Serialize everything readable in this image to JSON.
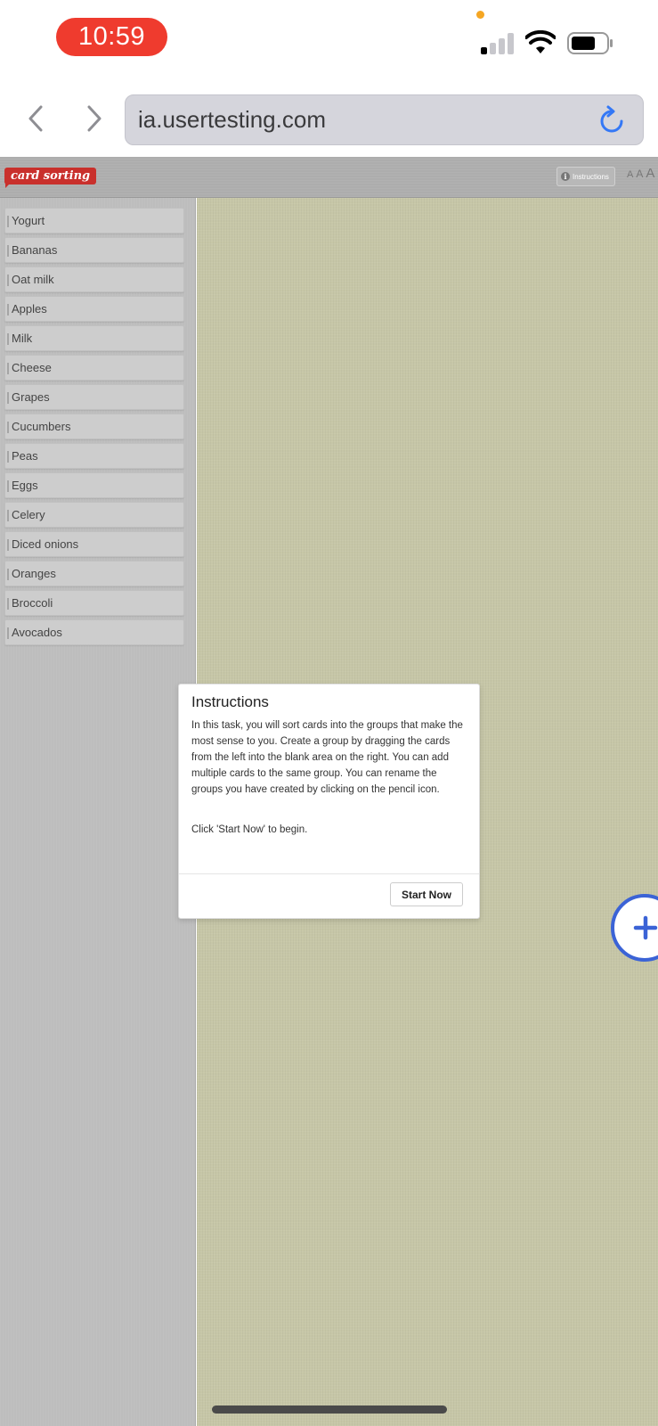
{
  "status_bar": {
    "time": "10:59"
  },
  "browser": {
    "url": "ia.usertesting.com"
  },
  "header": {
    "logo_text": "card sorting",
    "instructions_label": "Instructions",
    "font_sizes": [
      "A",
      "A",
      "A"
    ]
  },
  "cards": [
    "Yogurt",
    "Bananas",
    "Oat milk",
    "Apples",
    "Milk",
    "Cheese",
    "Grapes",
    "Cucumbers",
    "Peas",
    "Eggs",
    "Celery",
    "Diced onions",
    "Oranges",
    "Broccoli",
    "Avocados"
  ],
  "modal": {
    "title": "Instructions",
    "body": "In this task, you will sort cards into the groups that make the most sense to you. Create a group by dragging the cards from the left into the blank area on the right. You can add multiple cards to the same group. You can rename the groups you have created by clicking on the pencil icon.",
    "begin_text": "Click 'Start Now' to begin.",
    "start_button": "Start Now"
  },
  "colors": {
    "time_pill": "#ef3b2e",
    "logo": "#c9302c",
    "accent_blue": "#3b63d6",
    "drop_area": "#c6c6a7"
  }
}
